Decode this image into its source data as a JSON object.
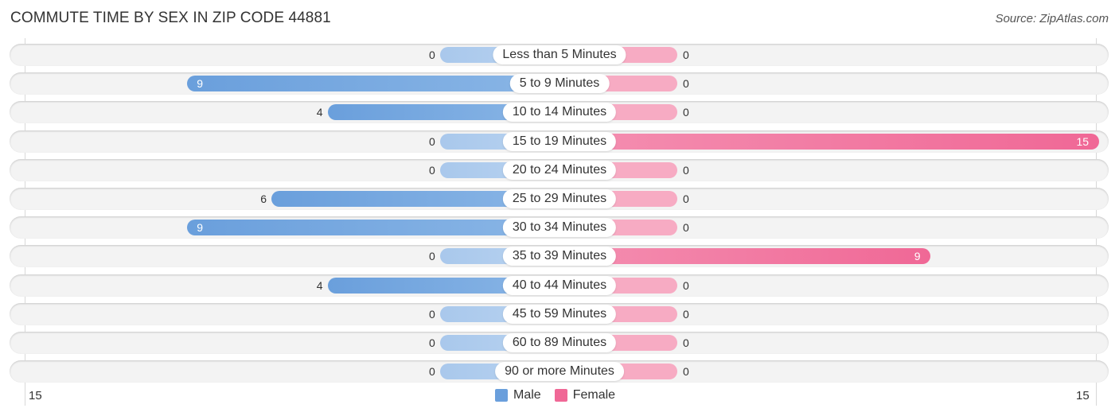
{
  "chart_data": {
    "type": "bar",
    "orientation": "horizontal-diverging",
    "title": "COMMUTE TIME BY SEX IN ZIP CODE 44881",
    "source": "Source: ZipAtlas.com",
    "categories": [
      "Less than 5 Minutes",
      "5 to 9 Minutes",
      "10 to 14 Minutes",
      "15 to 19 Minutes",
      "20 to 24 Minutes",
      "25 to 29 Minutes",
      "30 to 34 Minutes",
      "35 to 39 Minutes",
      "40 to 44 Minutes",
      "45 to 59 Minutes",
      "60 to 89 Minutes",
      "90 or more Minutes"
    ],
    "series": [
      {
        "name": "Male",
        "color": "#6a9fdc",
        "values": [
          0,
          9,
          4,
          0,
          0,
          6,
          9,
          0,
          4,
          0,
          0,
          0
        ]
      },
      {
        "name": "Female",
        "color": "#f06896",
        "values": [
          0,
          0,
          0,
          15,
          0,
          0,
          0,
          9,
          0,
          0,
          0,
          0
        ]
      }
    ],
    "axis": {
      "left_max_label": "15",
      "right_max_label": "15",
      "range": [
        15,
        15
      ]
    },
    "legend": {
      "position": "bottom-center",
      "entries": [
        "Male",
        "Female"
      ]
    }
  }
}
